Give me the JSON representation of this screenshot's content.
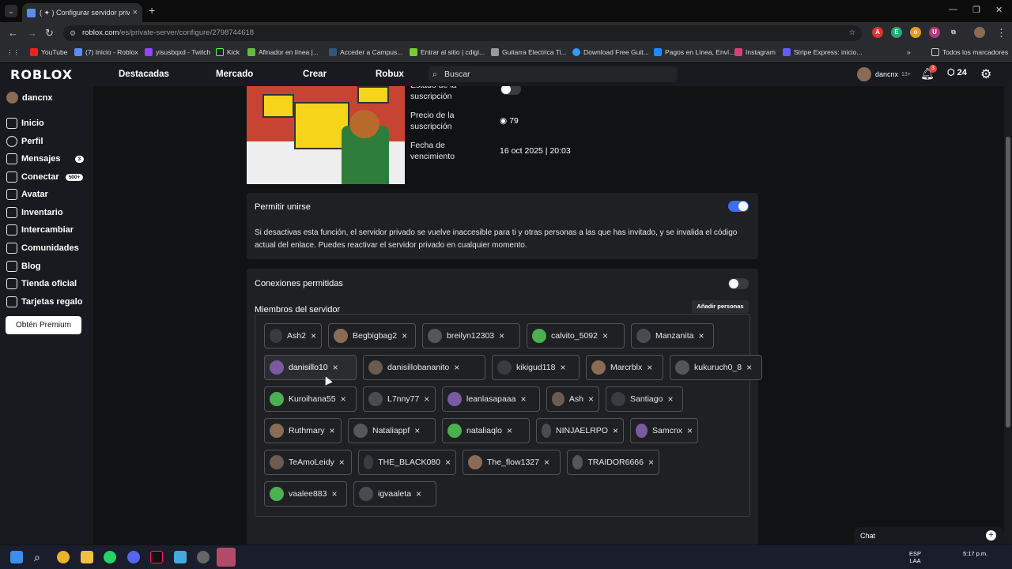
{
  "browser": {
    "tab_title": "( ✦ ) Configurar servidor privad",
    "url_site": "roblox.com",
    "url_path": "/es/private-server/configure/2798744618",
    "bookmarks": [
      "YouTube",
      "(7) Inicio - Roblox",
      "yisusbqxd - Twitch",
      "Kick",
      "Afinador en línea |...",
      "Acceder a Campus...",
      "Entrar al sitio | cdigi...",
      "Guitarra Electrica Ti...",
      "Download Free Guit...",
      "Pagos en Línea, Enví...",
      "Instagram",
      "Stripe Express: inicio..."
    ],
    "bookmarks_folder": "Todos los marcadores"
  },
  "header": {
    "logo": "ROBLOX",
    "nav": [
      "Destacadas",
      "Mercado",
      "Crear",
      "Robux"
    ],
    "search_placeholder": "Buscar",
    "username": "dancnx",
    "age_badge": "13+",
    "notifications": "3",
    "robux_balance": "24"
  },
  "sidebar": {
    "username": "dancnx",
    "items": [
      {
        "label": "Inicio",
        "icon": "home-icon"
      },
      {
        "label": "Perfil",
        "icon": "profile-icon"
      },
      {
        "label": "Mensajes",
        "icon": "messages-icon",
        "badge": "3"
      },
      {
        "label": "Conectar",
        "icon": "connect-icon",
        "badge": "500+"
      },
      {
        "label": "Avatar",
        "icon": "avatar-icon"
      },
      {
        "label": "Inventario",
        "icon": "inventory-icon"
      },
      {
        "label": "Intercambiar",
        "icon": "trade-icon"
      },
      {
        "label": "Comunidades",
        "icon": "communities-icon"
      },
      {
        "label": "Blog",
        "icon": "blog-icon"
      },
      {
        "label": "Tienda oficial",
        "icon": "store-icon"
      },
      {
        "label": "Tarjetas regalo",
        "icon": "giftcard-icon"
      }
    ],
    "premium_button": "Obtén Premium"
  },
  "subscription": {
    "status_label": "Estado de la suscripción",
    "price_label": "Precio de la suscripción",
    "price_value": "79",
    "expiry_label": "Fecha de vencimiento",
    "expiry_value": "16 oct 2025 | 20:03"
  },
  "allow_join": {
    "title": "Permitir unirse",
    "enabled": true,
    "description": "Si desactivas esta función, el servidor privado se vuelve inaccesible para ti y otras personas a las que has invitado, y se invalida el código actual del enlace. Puedes reactivar el servidor privado en cualquier momento."
  },
  "connections": {
    "title": "Conexiones permitidas",
    "enabled": false,
    "members_title": "Miembros del servidor",
    "add_button": "Añadir personas",
    "members": [
      [
        "Ash2",
        "Begbigbag2",
        "breilyn12303",
        "calvito_5092",
        "Manzanita"
      ],
      [
        "danisillo10",
        "danisillobananito",
        "kikigud118",
        "Marcrblx",
        "kukuruch0_8"
      ],
      [
        "Kuroihana55",
        "L7nny77",
        "leanlasapaaa",
        "Ash",
        "Santiago"
      ],
      [
        "Ruthmary",
        "Nataliappf",
        "nataliaqlo",
        "NINJAELRPO",
        "Samcnx"
      ],
      [
        "TeAmoLeidy",
        "THE_BLACK080",
        "The_flow1327",
        "TRAIDOR6666"
      ],
      [
        "vaalee883",
        "igvaaleta"
      ]
    ]
  },
  "chat": {
    "label": "Chat"
  },
  "taskbar": {
    "lang": "ESP",
    "lang2": "LAA",
    "time": "5:17 p.m."
  }
}
